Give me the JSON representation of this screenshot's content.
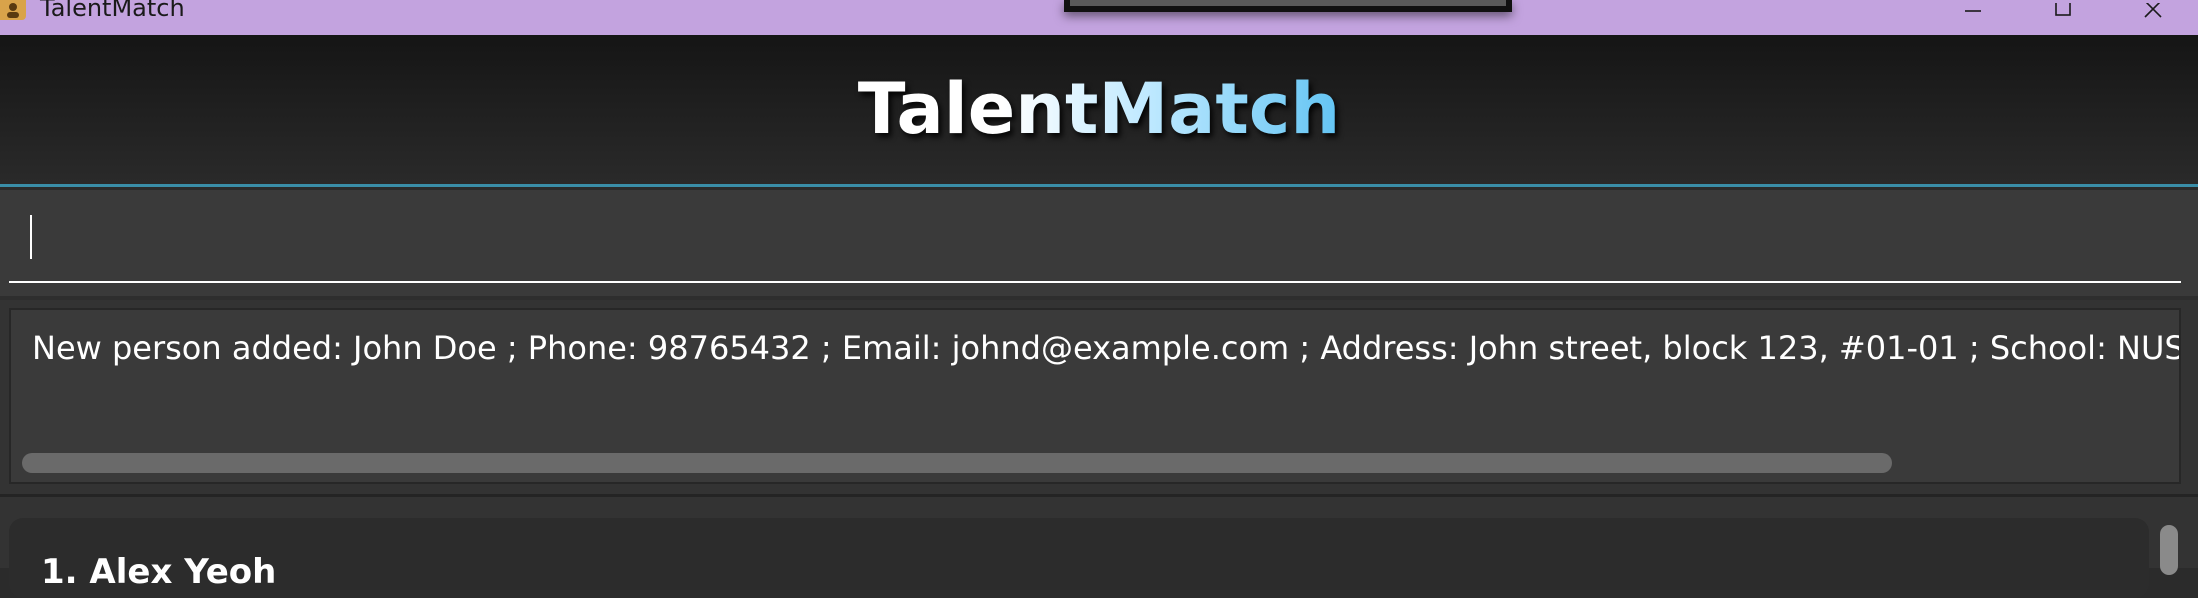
{
  "window": {
    "title": "TalentMatch",
    "controls": [
      "minimize-icon",
      "maximize-icon",
      "close-icon"
    ]
  },
  "header": {
    "brand": "TalentMatch"
  },
  "command_box": {
    "value": "",
    "placeholder": ""
  },
  "result_display": {
    "text": "New person added: John Doe ; Phone: 98765432 ; Email: johnd@example.com ; Address: John street, block 123, #01-01 ; School: NUS ; Degree: Com"
  },
  "person_list": {
    "items": [
      {
        "name": "1. Alex Yeoh"
      }
    ]
  },
  "colors": {
    "titlebar": "#c3a3df",
    "accent_border": "#3a8ea8",
    "brand_gradient_end": "#63c4f3",
    "background": "#3a3a3a"
  }
}
